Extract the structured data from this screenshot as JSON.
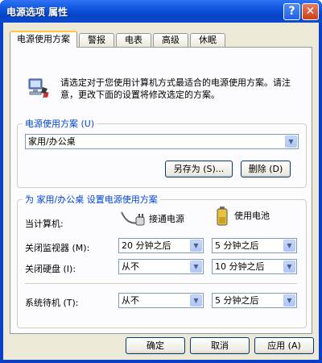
{
  "window": {
    "title": "电源选项 属性",
    "help_glyph": "?",
    "close_glyph": "✕"
  },
  "tabs": [
    {
      "label": "电源使用方案",
      "active": true
    },
    {
      "label": "警报",
      "active": false
    },
    {
      "label": "电表",
      "active": false
    },
    {
      "label": "高级",
      "active": false
    },
    {
      "label": "休眠",
      "active": false
    }
  ],
  "intro": {
    "icon": "power-scheme-icon",
    "text": "请选定对于您使用计算机方式最适合的电源使用方案。请注意，更改下面的设置将修改选定的方案。"
  },
  "scheme_group": {
    "legend": "电源使用方案 (U)",
    "selected": "家用/办公桌",
    "save_as_label": "另存为 (S)...",
    "delete_label": "删除 (D)"
  },
  "settings_group": {
    "legend": "为 家用/办公桌 设置电源使用方案",
    "computer_label": "当计算机:",
    "ac_label": "接通电源",
    "battery_label": "使用电池",
    "ac_icon": "power-plug-icon",
    "battery_icon": "battery-icon",
    "rows": [
      {
        "label": "关闭监视器 (M):",
        "ac": "20 分钟之后",
        "battery": "5 分钟之后"
      },
      {
        "label": "关闭硬盘 (I):",
        "ac": "从不",
        "battery": "10 分钟之后"
      },
      {
        "label": "系统待机 (T):",
        "ac": "从不",
        "battery": "5 分钟之后"
      }
    ]
  },
  "footer": {
    "ok_label": "确定",
    "cancel_label": "取消",
    "apply_label": "应用 (A)"
  },
  "colors": {
    "title_bar": "#0b52dc",
    "accent": "#0046d5",
    "dialog_bg": "#ece9d8",
    "tab_highlight": "#ffc83c"
  }
}
